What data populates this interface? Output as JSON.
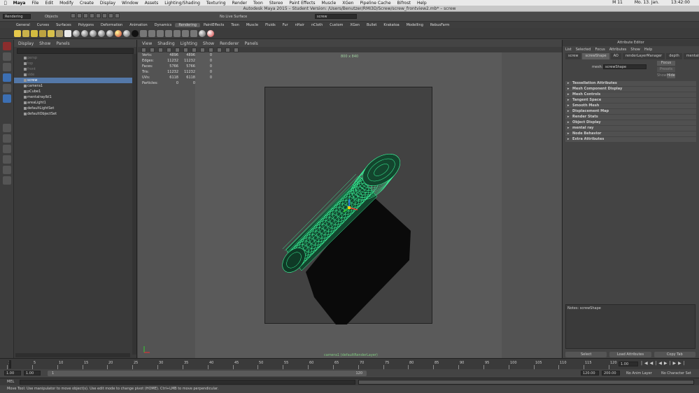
{
  "macbar": {
    "app": "Maya",
    "menus": [
      "File",
      "Edit",
      "Modify",
      "Create",
      "Display",
      "Window",
      "Assets",
      "Lighting/Shading",
      "Texturing",
      "Render",
      "Toon",
      "Stereo",
      "Paint Effects",
      "Muscle",
      "XGen",
      "Pipeline Cache",
      "Bifrost",
      "Help"
    ],
    "right": [
      "M 11",
      "Mo. 13. Jan.",
      "13:42:00"
    ]
  },
  "window_title": "Autodesk Maya 2015 – Student Version: /Users/Benutzer/RMI3D/Screw/screw_frontview2.mb* – screw",
  "statusline": {
    "menu_set": "Rendering",
    "objects_label": "Objects",
    "live_surface": "No Live Surface",
    "search_value": "screw"
  },
  "shelf_tabs": [
    "General",
    "Curves",
    "Surfaces",
    "Polygons",
    "Deformation",
    "Animation",
    "Dynamics",
    "Rendering",
    "PaintEffects",
    "Toon",
    "Muscle",
    "Fluids",
    "Fur",
    "nHair",
    "nCloth",
    "Custom",
    "XGen",
    "Bullet",
    "Krakatoa",
    "Modelling",
    "RebusFarm"
  ],
  "shelf_active": "Rendering",
  "outliner": {
    "menu": [
      "Display",
      "Show",
      "Panels"
    ],
    "items": [
      {
        "label": "persp",
        "state": "dim"
      },
      {
        "label": "top",
        "state": "dim"
      },
      {
        "label": "front",
        "state": "dim"
      },
      {
        "label": "side",
        "state": "dim"
      },
      {
        "label": "screw",
        "state": "sel"
      },
      {
        "label": "camera1",
        "state": ""
      },
      {
        "label": "pCube1",
        "state": ""
      },
      {
        "label": "mentalrayIbl1",
        "state": ""
      },
      {
        "label": "areaLight1",
        "state": ""
      },
      {
        "label": "defaultLightSet",
        "state": ""
      },
      {
        "label": "defaultObjectSet",
        "state": ""
      }
    ]
  },
  "viewport": {
    "menu": [
      "View",
      "Shading",
      "Lighting",
      "Show",
      "Renderer",
      "Panels"
    ],
    "hud": [
      {
        "k": "Verts:",
        "a": "4896",
        "b": "4896",
        "c": "0"
      },
      {
        "k": "Edges:",
        "a": "11232",
        "b": "11232",
        "c": "0"
      },
      {
        "k": "Faces:",
        "a": "5766",
        "b": "5766",
        "c": "0"
      },
      {
        "k": "Tris:",
        "a": "11232",
        "b": "11232",
        "c": "0"
      },
      {
        "k": "UVs:",
        "a": "6118",
        "b": "6118",
        "c": "0"
      },
      {
        "k": "Particles:",
        "a": "0",
        "b": "0",
        "c": ""
      }
    ],
    "resolution": "800 x 840",
    "camera_label": "camera1 (defaultRenderLayer)"
  },
  "attribute_editor": {
    "title": "Attribute Editor",
    "menu": [
      "List",
      "Selected",
      "Focus",
      "Attributes",
      "Show",
      "Help"
    ],
    "tabs": [
      "screw",
      "screwShape",
      "AO",
      "renderLayerManager",
      "depth",
      "mentalrayIt"
    ],
    "active_tab": "screwShape",
    "mesh_label": "mesh:",
    "mesh_value": "screwShape",
    "focus_label": "Focus",
    "presets_label": "Presets",
    "show_label": "Show",
    "hide_label": "Hide",
    "sections": [
      "Tessellation Attributes",
      "Mesh Component Display",
      "Mesh Controls",
      "Tangent Space",
      "Smooth Mesh",
      "Displacement Map",
      "Render Stats",
      "Object Display",
      "mental ray",
      "Node Behavior",
      "Extra Attributes"
    ],
    "notes_label": "Notes: screwShape",
    "buttons": [
      "Select",
      "Load Attributes",
      "Copy Tab"
    ]
  },
  "timeline": {
    "ticks": [
      "1",
      "5",
      "10",
      "15",
      "20",
      "25",
      "30",
      "35",
      "40",
      "45",
      "50",
      "55",
      "60",
      "65",
      "70",
      "75",
      "80",
      "85",
      "90",
      "95",
      "100",
      "105",
      "110",
      "115",
      "120"
    ],
    "current_frame": "1.00"
  },
  "range": {
    "start": "1.00",
    "inner_start": "1.00",
    "slider_start": "1",
    "slider_end": "120",
    "inner_end": "120.00",
    "end": "200.00",
    "anim_layer": "No Anim Layer",
    "char_set": "No Character Set"
  },
  "cmdline": {
    "label": "MEL"
  },
  "helpline": "Move Tool: Use manipulator to move object(s). Use edit mode to change pivot (HOME). Ctrl+LMB to move perpendicular.",
  "colors": {
    "wire": "#3dffa0",
    "selection": "#5478a8"
  }
}
